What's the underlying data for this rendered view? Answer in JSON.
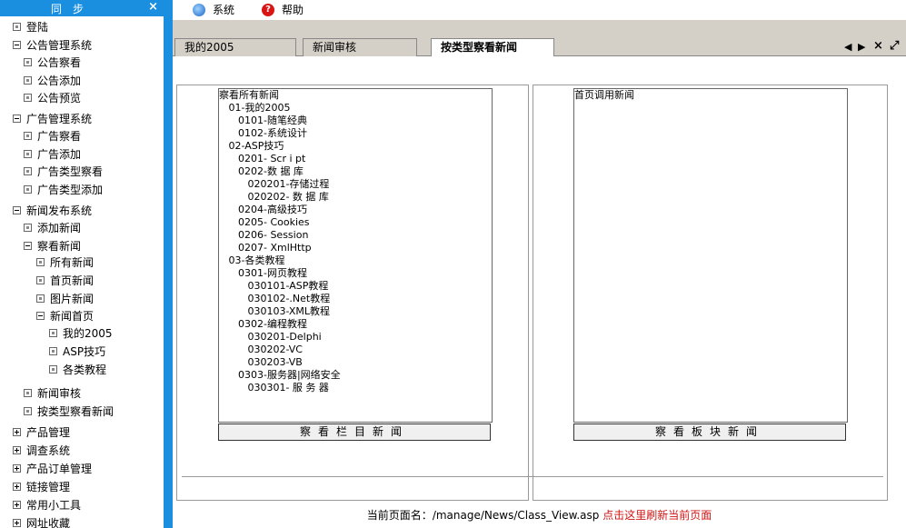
{
  "sidebar": {
    "title": "同步",
    "close_label": "×",
    "items": [
      {
        "label": "登陆",
        "level": 0,
        "icon": "leaf"
      },
      {
        "label": "公告管理系统",
        "level": 0,
        "icon": "minus"
      },
      {
        "label": "公告察看",
        "level": 1,
        "icon": "leaf"
      },
      {
        "label": "公告添加",
        "level": 1,
        "icon": "leaf"
      },
      {
        "label": "公告预览",
        "level": 1,
        "icon": "leaf"
      },
      {
        "label": "广告管理系统",
        "level": 0,
        "icon": "minus"
      },
      {
        "label": "广告察看",
        "level": 1,
        "icon": "leaf"
      },
      {
        "label": "广告添加",
        "level": 1,
        "icon": "leaf"
      },
      {
        "label": "广告类型察看",
        "level": 1,
        "icon": "leaf"
      },
      {
        "label": "广告类型添加",
        "level": 1,
        "icon": "leaf"
      },
      {
        "label": "新闻发布系统",
        "level": 0,
        "icon": "minus"
      },
      {
        "label": "添加新闻",
        "level": 1,
        "icon": "leaf"
      },
      {
        "label": "察看新闻",
        "level": 1,
        "icon": "minus"
      },
      {
        "label": "所有新闻",
        "level": 2,
        "icon": "leaf"
      },
      {
        "label": "首页新闻",
        "level": 2,
        "icon": "leaf"
      },
      {
        "label": "图片新闻",
        "level": 2,
        "icon": "leaf"
      },
      {
        "label": "新闻首页",
        "level": 2,
        "icon": "minus"
      },
      {
        "label": "我的2005",
        "level": 3,
        "icon": "leaf"
      },
      {
        "label": "ASP技巧",
        "level": 3,
        "icon": "leaf"
      },
      {
        "label": "各类教程",
        "level": 3,
        "icon": "leaf"
      },
      {
        "label": "新闻审核",
        "level": 1,
        "icon": "leaf"
      },
      {
        "label": "按类型察看新闻",
        "level": 1,
        "icon": "leaf"
      },
      {
        "label": "产品管理",
        "level": 0,
        "icon": "plus"
      },
      {
        "label": "调查系统",
        "level": 0,
        "icon": "plus"
      },
      {
        "label": "产品订单管理",
        "level": 0,
        "icon": "plus"
      },
      {
        "label": "链接管理",
        "level": 0,
        "icon": "plus"
      },
      {
        "label": "常用小工具",
        "level": 0,
        "icon": "plus"
      },
      {
        "label": "网址收藏",
        "level": 0,
        "icon": "plus"
      }
    ]
  },
  "topmenu": {
    "system_label": "系统",
    "system_icon": "globe-icon",
    "help_label": "帮助",
    "help_icon": "help-icon",
    "help_glyph": "?"
  },
  "tabs": {
    "items": [
      {
        "label": "我的2005",
        "active": false
      },
      {
        "label": "新闻审核",
        "active": false
      },
      {
        "label": "按类型察看新闻",
        "active": true
      }
    ],
    "controls": {
      "prev": "◀",
      "next": "▶",
      "close": "×",
      "maximize": "⤢"
    }
  },
  "left_panel": {
    "options": [
      "察看所有新闻",
      "   01-我的2005",
      "      0101-随笔经典",
      "      0102-系统设计",
      "   02-ASP技巧",
      "      0201- Scr i pt",
      "      0202-数 据 库",
      "         020201-存储过程",
      "         020202- 数 据 库",
      "      0204-高级技巧",
      "      0205- Cookies",
      "      0206- Session",
      "      0207- XmlHttp",
      "   03-各类教程",
      "      0301-网页教程",
      "         030101-ASP教程",
      "         030102-.Net教程",
      "         030103-XML教程",
      "      0302-编程教程",
      "         030201-Delphi",
      "         030202-VC",
      "         030203-VB",
      "      0303-服务器|网络安全",
      "         030301- 服 务 器"
    ],
    "button": "察看栏目新闻"
  },
  "right_panel": {
    "options": [
      "首页调用新闻"
    ],
    "button": "察看板块新闻"
  },
  "footer": {
    "prefix": "当前页面名：",
    "path": "/manage/News/Class_View.asp",
    "refresh_link": "点击这里刷新当前页面"
  },
  "colors": {
    "accent": "#1a8fe0",
    "tabstrip": "#d4d0c8",
    "link": "#d01414"
  }
}
